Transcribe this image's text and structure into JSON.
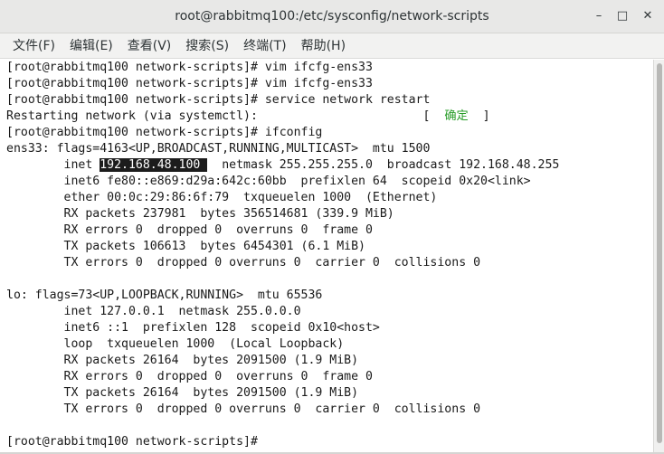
{
  "window": {
    "title": "root@rabbitmq100:/etc/sysconfig/network-scripts",
    "buttons": {
      "minimize": "–",
      "maximize": "□",
      "close": "✕"
    }
  },
  "menu": [
    "文件(F)",
    "编辑(E)",
    "查看(V)",
    "搜索(S)",
    "终端(T)",
    "帮助(H)"
  ],
  "terminal": {
    "lines": [
      "[root@rabbitmq100 network-scripts]# vim ifcfg-ens33",
      "[root@rabbitmq100 network-scripts]# vim ifcfg-ens33",
      "[root@rabbitmq100 network-scripts]# service network restart",
      {
        "pre": "Restarting network (via systemctl):                       [  ",
        "ok": "确定",
        "post": "  ]"
      },
      "[root@rabbitmq100 network-scripts]# ifconfig",
      "ens33: flags=4163<UP,BROADCAST,RUNNING,MULTICAST>  mtu 1500",
      {
        "pre": "        inet ",
        "sel": "192.168.48.100 ",
        "post": "  netmask 255.255.255.0  broadcast 192.168.48.255"
      },
      "        inet6 fe80::e869:d29a:642c:60bb  prefixlen 64  scopeid 0x20<link>",
      "        ether 00:0c:29:86:6f:79  txqueuelen 1000  (Ethernet)",
      "        RX packets 237981  bytes 356514681 (339.9 MiB)",
      "        RX errors 0  dropped 0  overruns 0  frame 0",
      "        TX packets 106613  bytes 6454301 (6.1 MiB)",
      "        TX errors 0  dropped 0 overruns 0  carrier 0  collisions 0",
      "",
      "lo: flags=73<UP,LOOPBACK,RUNNING>  mtu 65536",
      "        inet 127.0.0.1  netmask 255.0.0.0",
      "        inet6 ::1  prefixlen 128  scopeid 0x10<host>",
      "        loop  txqueuelen 1000  (Local Loopback)",
      "        RX packets 26164  bytes 2091500 (1.9 MiB)",
      "        RX errors 0  dropped 0  overruns 0  frame 0",
      "        TX packets 26164  bytes 2091500 (1.9 MiB)",
      "        TX errors 0  dropped 0 overruns 0  carrier 0  collisions 0",
      "",
      "[root@rabbitmq100 network-scripts]# "
    ]
  },
  "colors": {
    "ok_text": "#2a9d2a",
    "selection_bg": "#1c1c1c"
  }
}
